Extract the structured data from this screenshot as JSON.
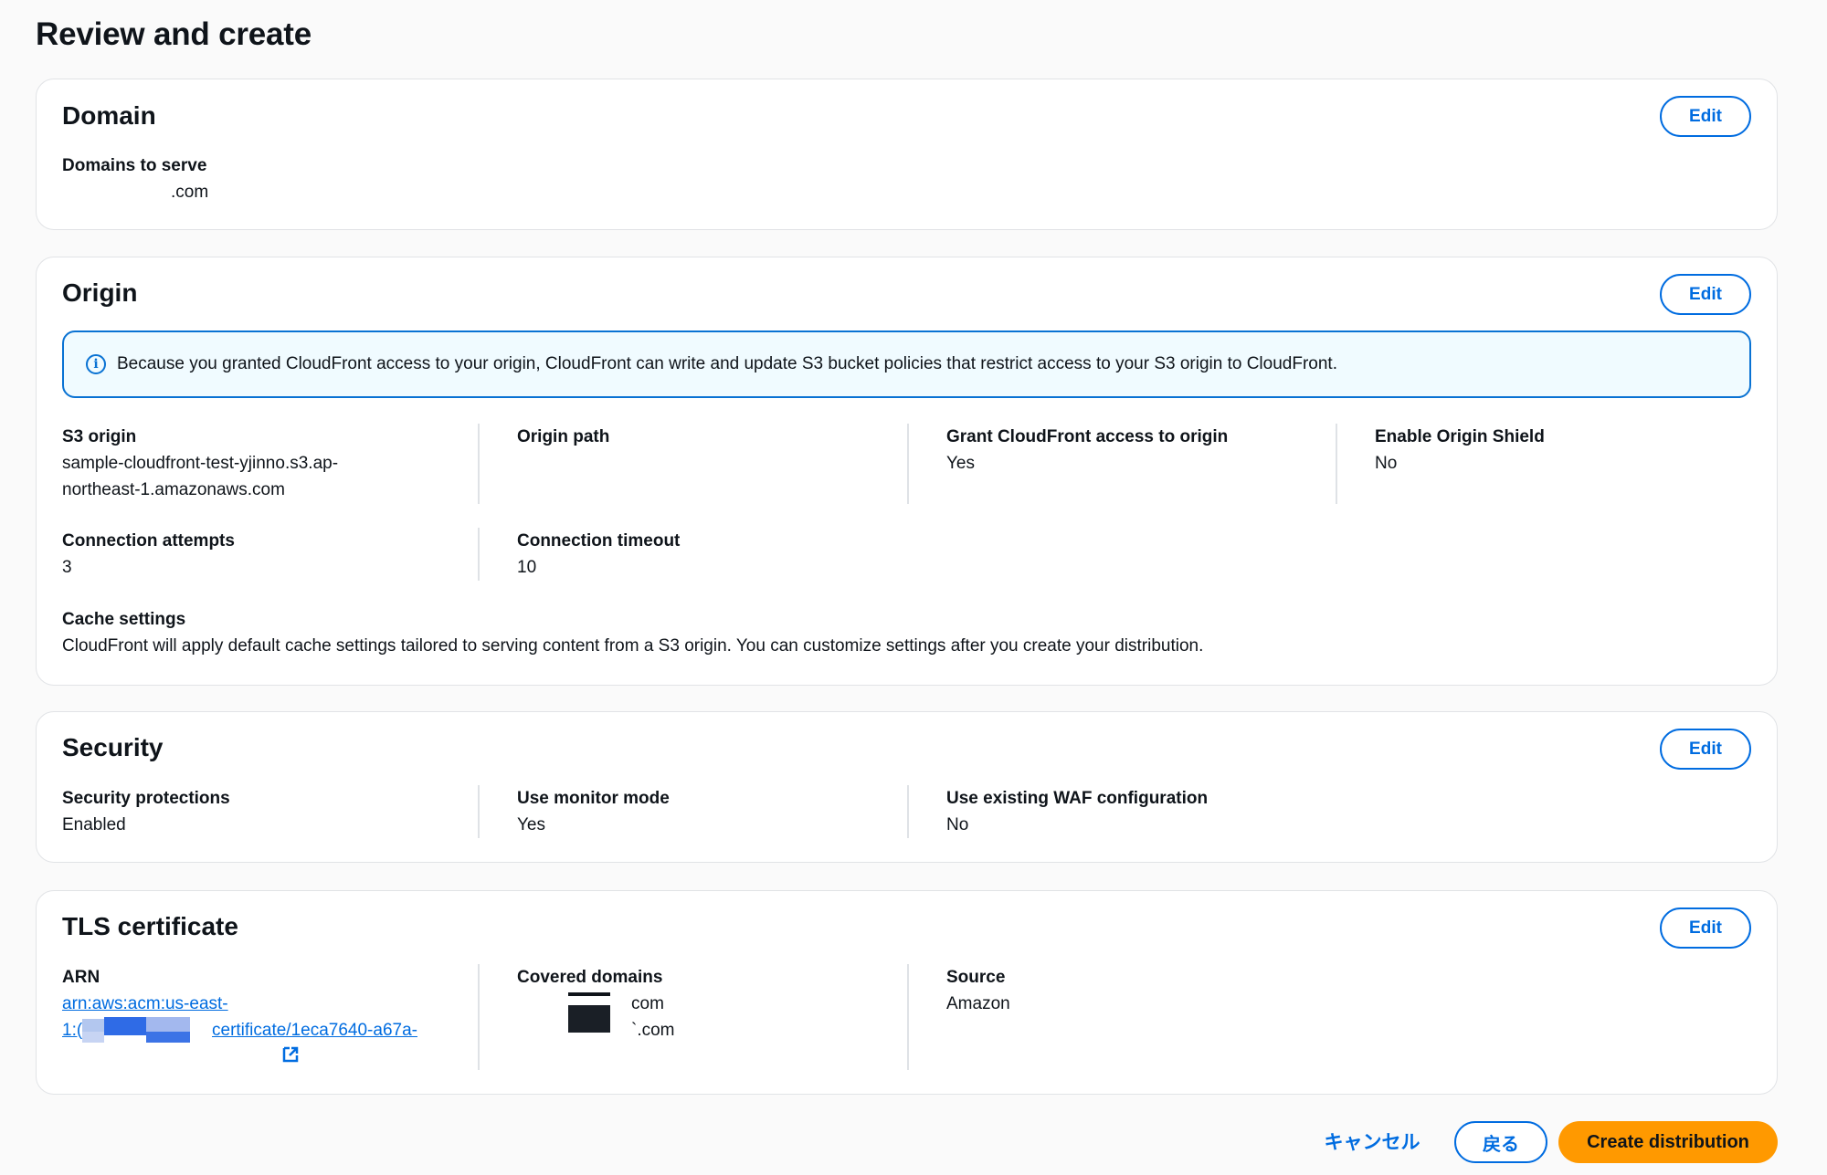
{
  "page": {
    "title": "Review and create"
  },
  "domain": {
    "title": "Domain",
    "edit_label": "Edit",
    "domains_to_serve_label": "Domains to serve",
    "domains_to_serve_value": ".com"
  },
  "origin": {
    "title": "Origin",
    "edit_label": "Edit",
    "info_text": "Because you granted CloudFront access to your origin, CloudFront can write and update S3 bucket policies that restrict access to your S3 origin to CloudFront.",
    "s3_origin_label": "S3 origin",
    "s3_origin_value_line1": "sample-cloudfront-test-yjinno.s3.ap-",
    "s3_origin_value_line2": "northeast-1.amazonaws.com",
    "origin_path_label": "Origin path",
    "origin_path_value": "",
    "grant_access_label": "Grant CloudFront access to origin",
    "grant_access_value": "Yes",
    "origin_shield_label": "Enable Origin Shield",
    "origin_shield_value": "No",
    "connection_attempts_label": "Connection attempts",
    "connection_attempts_value": "3",
    "connection_timeout_label": "Connection timeout",
    "connection_timeout_value": "10",
    "cache_settings_label": "Cache settings",
    "cache_settings_value": "CloudFront will apply default cache settings tailored to serving content from a S3 origin. You can customize settings after you create your distribution."
  },
  "security": {
    "title": "Security",
    "edit_label": "Edit",
    "protections_label": "Security protections",
    "protections_value": "Enabled",
    "monitor_mode_label": "Use monitor mode",
    "monitor_mode_value": "Yes",
    "waf_label": "Use existing WAF configuration",
    "waf_value": "No"
  },
  "tls": {
    "title": "TLS certificate",
    "edit_label": "Edit",
    "arn_label": "ARN",
    "arn_line1": "arn:aws:acm:us-east-",
    "arn_line2_prefix": "1:(",
    "arn_line2_suffix": "certificate/1eca7640-a67a-",
    "covered_domains_label": "Covered domains",
    "covered_domain_1": "com",
    "covered_domain_2": "`.com",
    "source_label": "Source",
    "source_value": "Amazon",
    "icons": {
      "external_link": "external-link-icon"
    }
  },
  "footer": {
    "cancel_label": "キャンセル",
    "back_label": "戻る",
    "create_label": "Create distribution"
  },
  "colors": {
    "accent_blue": "#006ce0",
    "primary_orange": "#ff9900",
    "info_bg": "#f0fbff",
    "text": "#0f141a"
  }
}
